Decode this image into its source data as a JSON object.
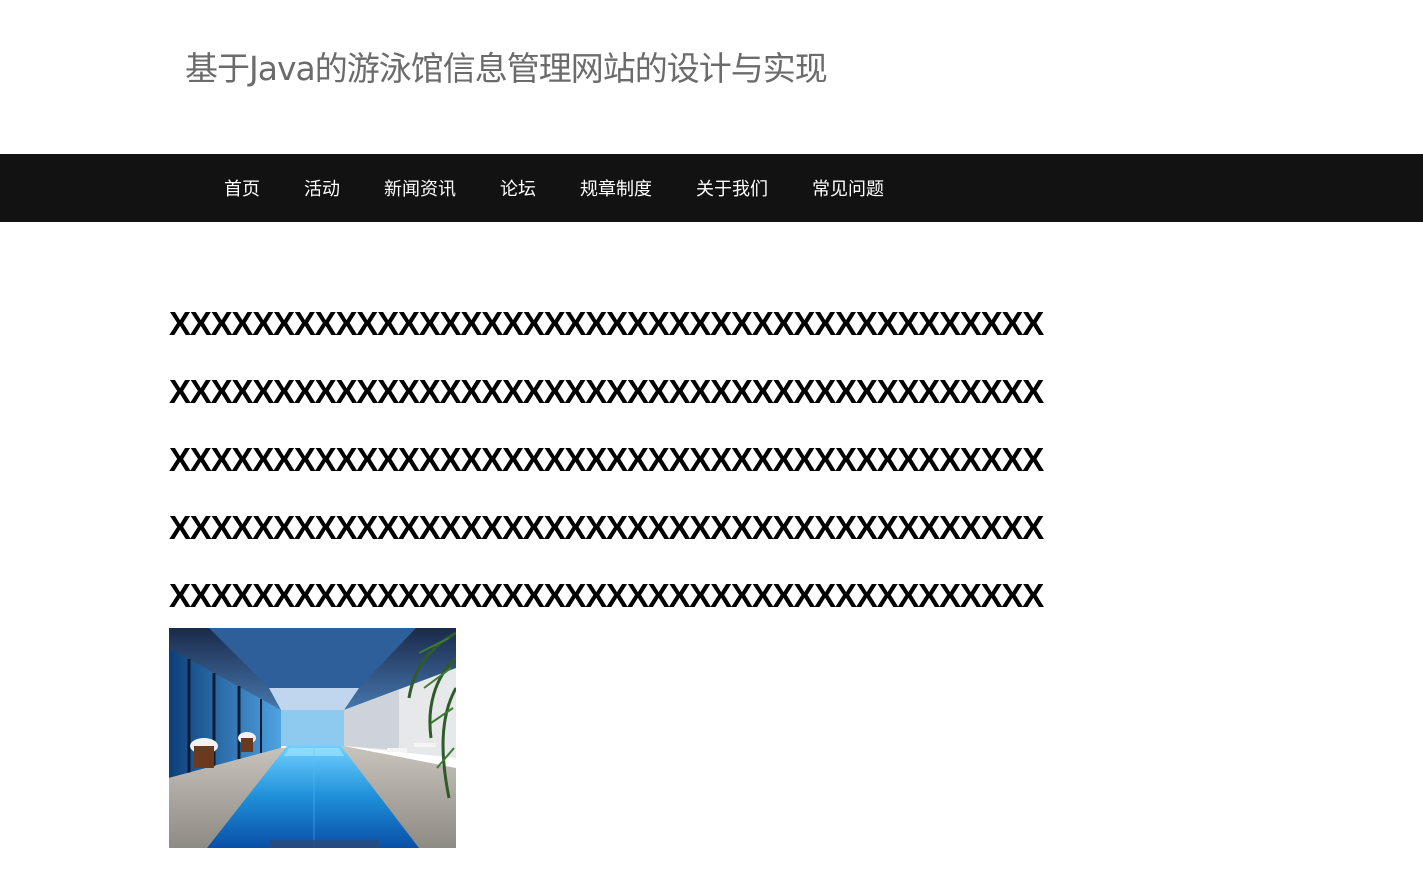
{
  "header": {
    "title": "基于Java的游泳馆信息管理网站的设计与实现"
  },
  "nav": {
    "items": [
      "首页",
      "活动",
      "新闻资讯",
      "论坛",
      "规章制度",
      "关于我们",
      "常见问题"
    ]
  },
  "article": {
    "lines": [
      "XXXXXXXXXXXXXXXXXXXXXXXXXXXXXXXXXXXXXXXXXX",
      "XXXXXXXXXXXXXXXXXXXXXXXXXXXXXXXXXXXXXXXXXX",
      "XXXXXXXXXXXXXXXXXXXXXXXXXXXXXXXXXXXXXXXXXX",
      "XXXXXXXXXXXXXXXXXXXXXXXXXXXXXXXXXXXXXXXXXX",
      "XXXXXXXXXXXXXXXXXXXXXXXXXXXXXXXXXXXXXXXXXX"
    ]
  },
  "colors": {
    "nav_background": "#121212",
    "title_text": "#6b6b6b",
    "pool_water": "#1e8fd8"
  }
}
